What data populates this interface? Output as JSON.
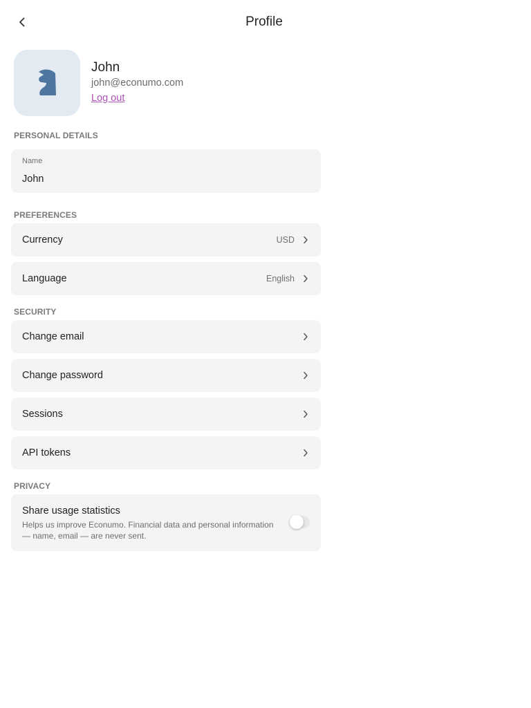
{
  "header": {
    "title": "Profile",
    "back_icon": "chevron-left-icon"
  },
  "profile": {
    "name": "John",
    "email": "john@econumo.com",
    "logout_label": "Log out",
    "avatar_icon": "chess-knight-icon",
    "avatar_bg": "#e3eaf1",
    "avatar_icon_color": "#4e76a0"
  },
  "personal_details": {
    "section_label": "PERSONAL DETAILS",
    "name_label": "Name",
    "name_value": "John"
  },
  "preferences": {
    "section_label": "PREFERENCES",
    "currency_label": "Currency",
    "currency_value": "USD",
    "language_label": "Language",
    "language_value": "English"
  },
  "security": {
    "section_label": "SECURITY",
    "items": [
      {
        "label": "Change email"
      },
      {
        "label": "Change password"
      },
      {
        "label": "Sessions"
      },
      {
        "label": "API tokens"
      }
    ]
  },
  "privacy": {
    "section_label": "PRIVACY",
    "title": "Share usage statistics",
    "description": "Helps us improve Econumo. Financial data and personal information — name, email — are never sent.",
    "toggle_on": false
  },
  "colors": {
    "link": "#ad52b6",
    "card_bg": "#f4f4f4",
    "section_label": "#7a7a7a"
  }
}
